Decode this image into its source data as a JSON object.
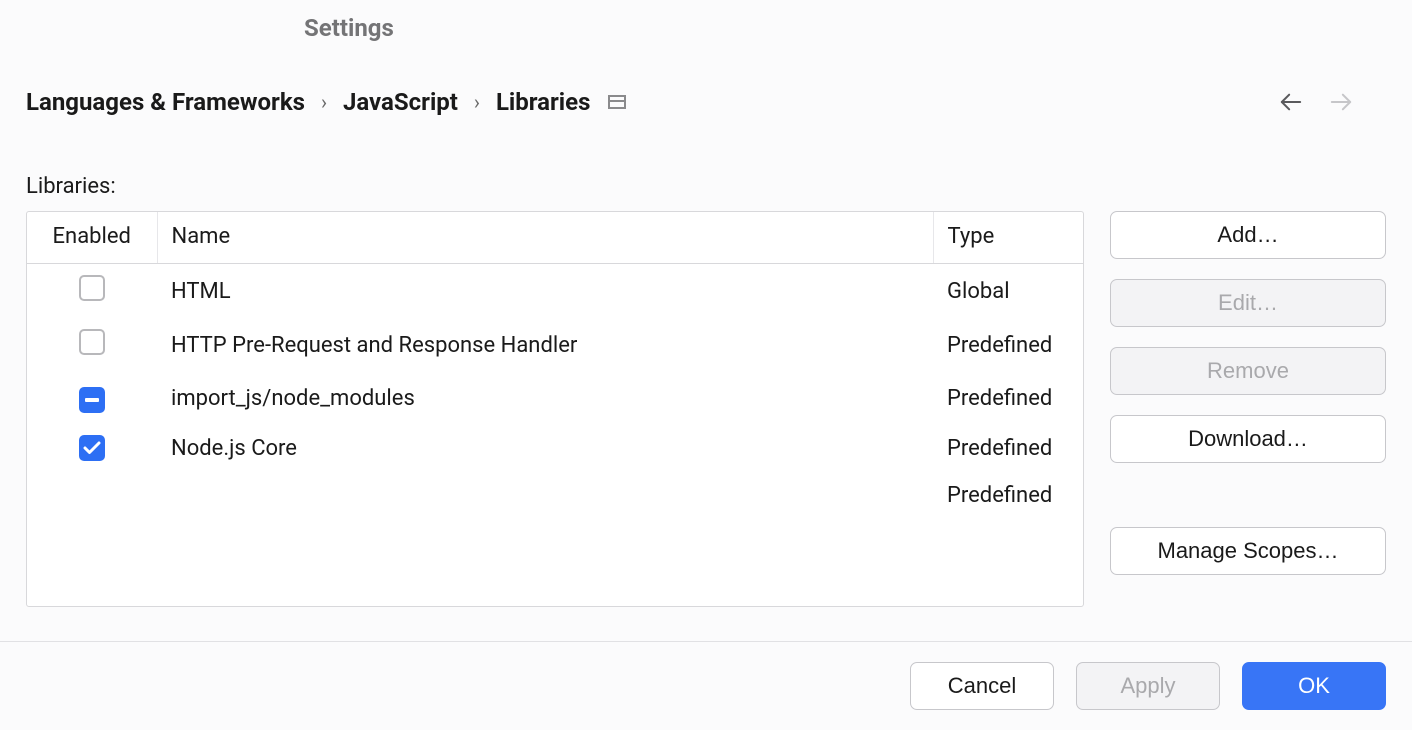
{
  "title": "Settings",
  "breadcrumb": {
    "segment0": "Languages & Frameworks",
    "segment1": "JavaScript",
    "segment2": "Libraries"
  },
  "section_label": "Libraries:",
  "columns": {
    "enabled": "Enabled",
    "name": "Name",
    "type": "Type"
  },
  "rows": [
    {
      "state": "unchecked",
      "name": "HTML",
      "type": "Global"
    },
    {
      "state": "unchecked",
      "name": "HTTP Pre-Request and Response Handler",
      "type": "Predefined"
    },
    {
      "state": "indeterminate",
      "name": "import_js/node_modules",
      "type": "Predefined"
    },
    {
      "state": "checked",
      "name": "Node.js Core",
      "type": "Predefined"
    },
    {
      "state": "none",
      "name": "",
      "type": "Predefined"
    }
  ],
  "side_buttons": {
    "add": "Add…",
    "edit": "Edit…",
    "remove": "Remove",
    "download": "Download…",
    "manage_scopes": "Manage Scopes…"
  },
  "footer": {
    "cancel": "Cancel",
    "apply": "Apply",
    "ok": "OK"
  }
}
